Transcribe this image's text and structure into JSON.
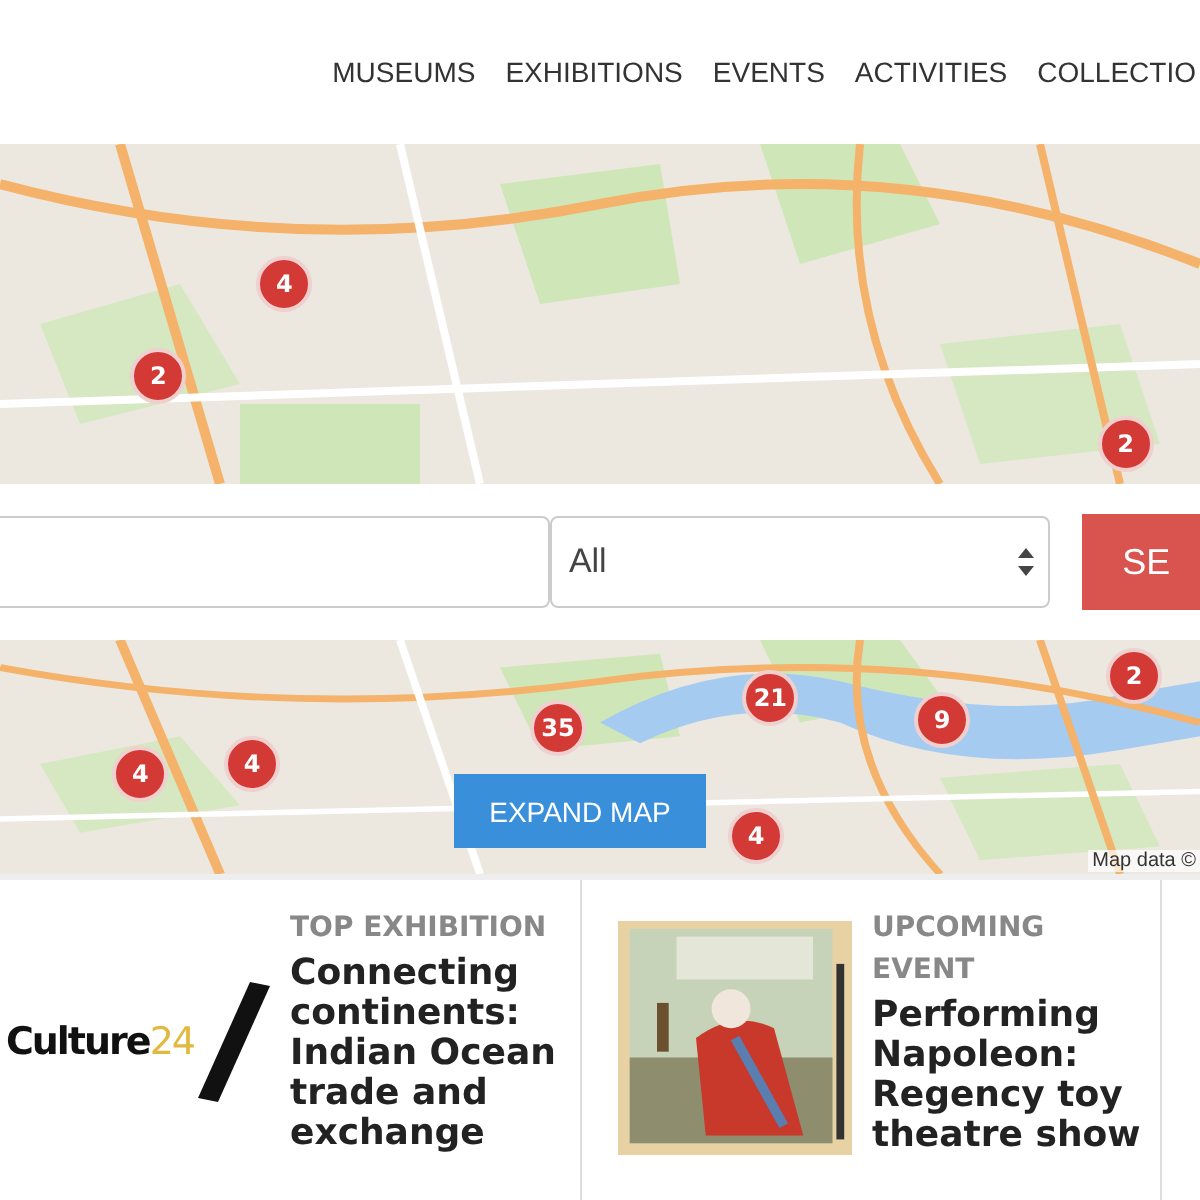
{
  "nav": [
    {
      "label": "MUSEUMS"
    },
    {
      "label": "EXHIBITIONS"
    },
    {
      "label": "EVENTS"
    },
    {
      "label": "ACTIVITIES"
    },
    {
      "label": "COLLECTIO"
    }
  ],
  "top_map": {
    "kind": "picture",
    "markers": [
      {
        "count": "4"
      },
      {
        "count": "2"
      },
      {
        "count": "2"
      }
    ]
  },
  "search": {
    "category": "All",
    "button": "SE"
  },
  "bottom_map": {
    "kind": "picture",
    "markers": [
      {
        "count": "35"
      },
      {
        "count": "21"
      },
      {
        "count": "9"
      },
      {
        "count": "2"
      },
      {
        "count": "4"
      },
      {
        "count": "4"
      },
      {
        "count": "4"
      }
    ],
    "button": "EXPAND MAP",
    "attribution": "Map data ©"
  },
  "cards": [
    {
      "kind": "logo",
      "logo": "Culture",
      "logo_accent": "24",
      "category": "TOP EXHIBITION",
      "title": "Connecting continents: Indian Ocean trade and exchange"
    },
    {
      "kind": "picture",
      "category": "UPCOMING EVENT",
      "title": "Performing Napoleon: Regency toy theatre show"
    }
  ]
}
